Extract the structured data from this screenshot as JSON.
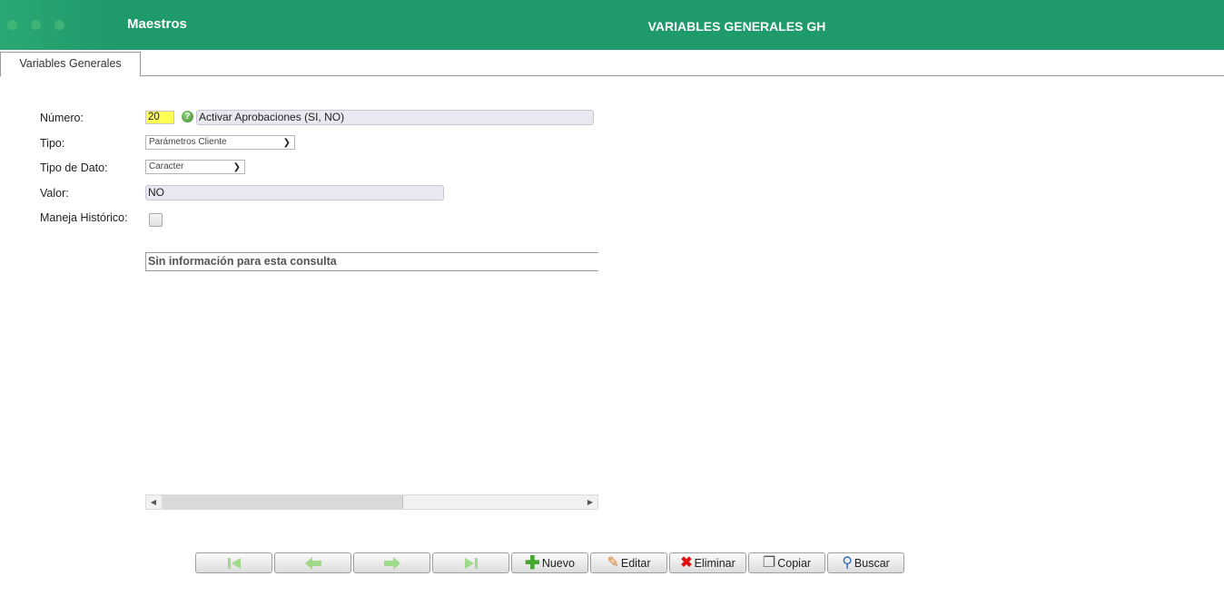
{
  "header": {
    "app_title": "Maestros",
    "page_title": "VARIABLES GENERALES GH",
    "color": "#1f9a6b"
  },
  "tabs": [
    {
      "label": "Variables Generales"
    }
  ],
  "form": {
    "numero_label": "Número:",
    "numero_value": "20",
    "numero_desc": "Activar Aprobaciones (SI, NO)",
    "tipo_label": "Tipo:",
    "tipo_value": "Parámetros Cliente",
    "tipo_dato_label": "Tipo de Dato:",
    "tipo_dato_value": "Caracter",
    "valor_label": "Valor:",
    "valor_value": "NO",
    "historico_label": "Maneja Histórico:",
    "historico_checked": false
  },
  "grid": {
    "empty_message": "Sin información para esta consulta"
  },
  "toolbar": {
    "first_icon": "first-record-icon",
    "prev_icon": "previous-arrow-icon",
    "next_icon": "next-arrow-icon",
    "last_icon": "last-record-icon",
    "nuevo_label": "Nuevo",
    "editar_label": "Editar",
    "eliminar_label": "Eliminar",
    "copiar_label": "Copiar",
    "buscar_label": "Buscar"
  }
}
